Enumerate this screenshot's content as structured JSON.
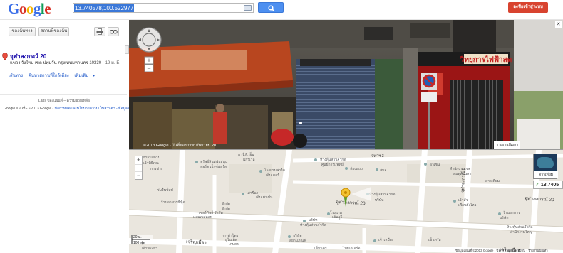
{
  "header": {
    "logo": "Google",
    "search_value": "13.740578,100.522977",
    "signin_label": "ลงชื่อเข้าสู่ระบบ"
  },
  "left_panel": {
    "btn_saved": "ของฉันทาง",
    "btn_myplaces": "สถานที่ของฉัน",
    "place_title": "จุฬาลงกรณ์ 20",
    "address": "แขวง วังใหม่ เขต ปทุมวัน กรุงเทพมหานคร 10330",
    "distance": "19 ม. E",
    "links": [
      "เส้นทาง",
      "ค้นหาสถานที่ใกล้เคียง",
      "เพิ่มเติม"
    ],
    "footer_labs": "Labs ของแผนที่ – ความช่วยเหลือ",
    "footer_copy": "Google แผนที่ - ©2013 Google -",
    "footer_terms": "ข้อกำหนดและนโยบายความเป็นส่วนตัว - ข้อมูลส่วนบุคคล"
  },
  "streetview": {
    "copyright": "©2013 Google · วันที่ของภาพ: กันยายน 2011",
    "report": "รายงานปัญหา",
    "store_sign": "วิทยุการไฟฟ้าสด"
  },
  "map": {
    "scale_m": "20 ม.",
    "scale_ft": "100 ฟุต",
    "coord_box": "13.7405",
    "thumb_label": "ดาวเทียม",
    "copyright": "ข้อมูลแผนที่ ©2013 Google · ข้อกำหนดการใช้งาน · รายงานปัญหา",
    "road_main": "จุฬาลงกรณ์ 20",
    "road_side": "จุฬาลงกรณ์ 5",
    "road_bottom": "เจริญเมือง",
    "road_bottom2": "เจริญเมือง",
    "road_top3": "จุฬาฯ 3",
    "labels": [
      "ธรรมสถาน",
      "เจ้าพิธีคุณ",
      "การช่าง",
      "ทรัพย์สินสนับสนุน",
      "พอร์ท เอ็กซ์พอร์ท",
      "โรงแรมพาร์ค",
      "เอ็นเตอร์",
      "อาร์.พี.เอ็ม",
      "แกรเวล",
      "ห้างหุ้นส่วนจำกัด",
      "ศูนย์การแพทย์",
      "ห้องแถว",
      "สมอ",
      "อาเซน",
      "ห้างหุ้นส่วนจำกัด",
      "บริษัท",
      "เสารีนา",
      "เอ็นเซนชั่น",
      "จำกัด",
      "จำกัด",
      "ร่มรื่นช็อป",
      "ร้านอาหารซีฟู้ด",
      "สำนักงานเขต",
      "สมดุลยนคร",
      "ดาวเทียม",
      "บริษัท",
      "ห้างหุ้นส่วนจำกัด",
      "โรงแรม",
      "เซ็นจูรี่",
      "เจ้าสัว",
      "เพื่อนยังไหว",
      "ร้านอาหาร",
      "บริษัท",
      "ห้างหุ้นส่วนจำกัด",
      "สำนักงานใหญ่",
      "เซอร์กันธ์ จำกัด",
      "แอมเบสดอท",
      "การค้าไทย",
      "ยูไนเต็ด",
      "เกษตร",
      "บริษัท",
      "สยามภัณฑ์",
      "เจ้าเหมือง",
      "เซ็นทรัล",
      "เต็มนคร",
      "ไทยเดินเรือ",
      "เจ้าพระยา"
    ]
  }
}
